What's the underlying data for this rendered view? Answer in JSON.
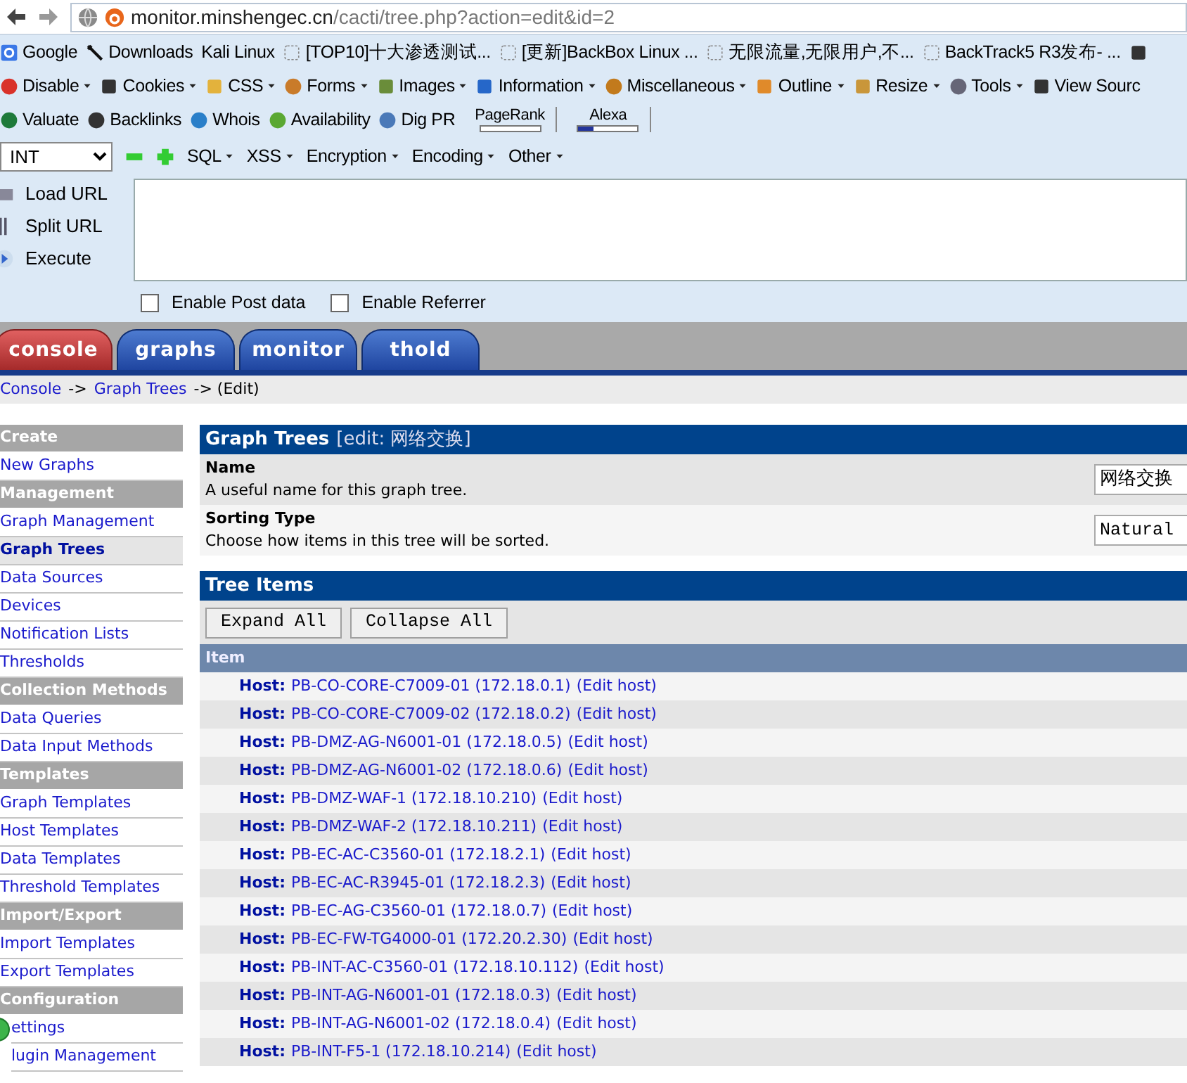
{
  "browser": {
    "url_host": "monitor.minshengec.cn",
    "url_path": "/cacti/tree.php?action=edit&id=2",
    "bookmarks": [
      "Google",
      "Downloads",
      "Kali Linux",
      "[TOP10]十大渗透测试...",
      "[更新]BackBox Linux ...",
      "无限流量,无限用户,不...",
      "BackTrack5 R3发布- ..."
    ],
    "dev_toolbar": [
      {
        "label": "Disable",
        "dropdown": true
      },
      {
        "label": "Cookies",
        "dropdown": true
      },
      {
        "label": "CSS",
        "dropdown": true
      },
      {
        "label": "Forms",
        "dropdown": true
      },
      {
        "label": "Images",
        "dropdown": true
      },
      {
        "label": "Information",
        "dropdown": true
      },
      {
        "label": "Miscellaneous",
        "dropdown": true
      },
      {
        "label": "Outline",
        "dropdown": true
      },
      {
        "label": "Resize",
        "dropdown": true
      },
      {
        "label": "Tools",
        "dropdown": true
      },
      {
        "label": "View Sourc",
        "dropdown": false
      }
    ],
    "seo_toolbar": [
      {
        "label": "Valuate"
      },
      {
        "label": "Backlinks"
      },
      {
        "label": "Whois"
      },
      {
        "label": "Availability"
      },
      {
        "label": "Dig PR"
      }
    ],
    "pagerank": {
      "label": "PageRank",
      "level": 0
    },
    "alexa": {
      "label": "Alexa",
      "level": 0.25
    }
  },
  "hackbar": {
    "select": "INT",
    "menus": [
      {
        "label": "SQL"
      },
      {
        "label": "XSS"
      },
      {
        "label": "Encryption"
      },
      {
        "label": "Encoding"
      },
      {
        "label": "Other"
      }
    ],
    "actions": [
      {
        "label": "Load URL"
      },
      {
        "label": "Split URL"
      },
      {
        "label": "Execute"
      }
    ],
    "options": [
      {
        "label": "Enable Post data",
        "checked": false
      },
      {
        "label": "Enable Referrer",
        "checked": false
      }
    ]
  },
  "tabs": [
    {
      "label": "console",
      "selected": true
    },
    {
      "label": "graphs",
      "selected": false
    },
    {
      "label": "monitor",
      "selected": false
    },
    {
      "label": "thold",
      "selected": false
    }
  ],
  "breadcrumb": [
    {
      "label": "Console",
      "link": true
    },
    {
      "label": "->",
      "link": false
    },
    {
      "label": "Graph Trees",
      "link": true
    },
    {
      "label": "-> (Edit)",
      "link": false
    }
  ],
  "sidebar": [
    {
      "kind": "header",
      "label": "Create"
    },
    {
      "kind": "link",
      "label": "New Graphs",
      "selected": false
    },
    {
      "kind": "header",
      "label": "Management"
    },
    {
      "kind": "link",
      "label": "Graph Management",
      "selected": false
    },
    {
      "kind": "link",
      "label": "Graph Trees",
      "selected": true
    },
    {
      "kind": "link",
      "label": "Data Sources",
      "selected": false
    },
    {
      "kind": "link",
      "label": "Devices",
      "selected": false
    },
    {
      "kind": "link",
      "label": "Notification Lists",
      "selected": false
    },
    {
      "kind": "link",
      "label": "Thresholds",
      "selected": false
    },
    {
      "kind": "header",
      "label": "Collection Methods"
    },
    {
      "kind": "link",
      "label": "Data Queries",
      "selected": false
    },
    {
      "kind": "link",
      "label": "Data Input Methods",
      "selected": false
    },
    {
      "kind": "header",
      "label": "Templates"
    },
    {
      "kind": "link",
      "label": "Graph Templates",
      "selected": false
    },
    {
      "kind": "link",
      "label": "Host Templates",
      "selected": false
    },
    {
      "kind": "link",
      "label": "Data Templates",
      "selected": false
    },
    {
      "kind": "link",
      "label": "Threshold Templates",
      "selected": false
    },
    {
      "kind": "header",
      "label": "Import/Export"
    },
    {
      "kind": "link",
      "label": "Import Templates",
      "selected": false
    },
    {
      "kind": "link",
      "label": "Export Templates",
      "selected": false
    },
    {
      "kind": "header",
      "label": "Configuration"
    },
    {
      "kind": "link",
      "label": "ettings",
      "selected": false
    },
    {
      "kind": "link",
      "label": "lugin Management",
      "selected": false
    }
  ],
  "form": {
    "title": "Graph Trees",
    "title_note": "[edit: 网络交换]",
    "fields": [
      {
        "label": "Name",
        "description": "A useful name for this graph tree.",
        "value": "网络交换"
      },
      {
        "label": "Sorting Type",
        "description": "Choose how items in this tree will be sorted.",
        "value": "Natural"
      }
    ]
  },
  "tree": {
    "title": "Tree Items",
    "buttons": [
      "Expand All",
      "Collapse All"
    ],
    "column": "Item",
    "rows": [
      {
        "label": "Host:",
        "host": "PB-CO-CORE-C7009-01 (172.18.0.1)",
        "action": "(Edit host)"
      },
      {
        "label": "Host:",
        "host": "PB-CO-CORE-C7009-02 (172.18.0.2)",
        "action": "(Edit host)"
      },
      {
        "label": "Host:",
        "host": "PB-DMZ-AG-N6001-01 (172.18.0.5)",
        "action": "(Edit host)"
      },
      {
        "label": "Host:",
        "host": "PB-DMZ-AG-N6001-02 (172.18.0.6)",
        "action": "(Edit host)"
      },
      {
        "label": "Host:",
        "host": "PB-DMZ-WAF-1 (172.18.10.210)",
        "action": "(Edit host)"
      },
      {
        "label": "Host:",
        "host": "PB-DMZ-WAF-2 (172.18.10.211)",
        "action": "(Edit host)"
      },
      {
        "label": "Host:",
        "host": "PB-EC-AC-C3560-01 (172.18.2.1)",
        "action": "(Edit host)"
      },
      {
        "label": "Host:",
        "host": "PB-EC-AC-R3945-01 (172.18.2.3)",
        "action": "(Edit host)"
      },
      {
        "label": "Host:",
        "host": "PB-EC-AG-C3560-01 (172.18.0.7)",
        "action": "(Edit host)"
      },
      {
        "label": "Host:",
        "host": "PB-EC-FW-TG4000-01 (172.20.2.30)",
        "action": "(Edit host)"
      },
      {
        "label": "Host:",
        "host": "PB-INT-AC-C3560-01 (172.18.10.112)",
        "action": "(Edit host)"
      },
      {
        "label": "Host:",
        "host": "PB-INT-AG-N6001-01 (172.18.0.3)",
        "action": "(Edit host)"
      },
      {
        "label": "Host:",
        "host": "PB-INT-AG-N6001-02 (172.18.0.4)",
        "action": "(Edit host)"
      },
      {
        "label": "Host:",
        "host": "PB-INT-F5-1 (172.18.10.214)",
        "action": "(Edit host)"
      }
    ]
  }
}
